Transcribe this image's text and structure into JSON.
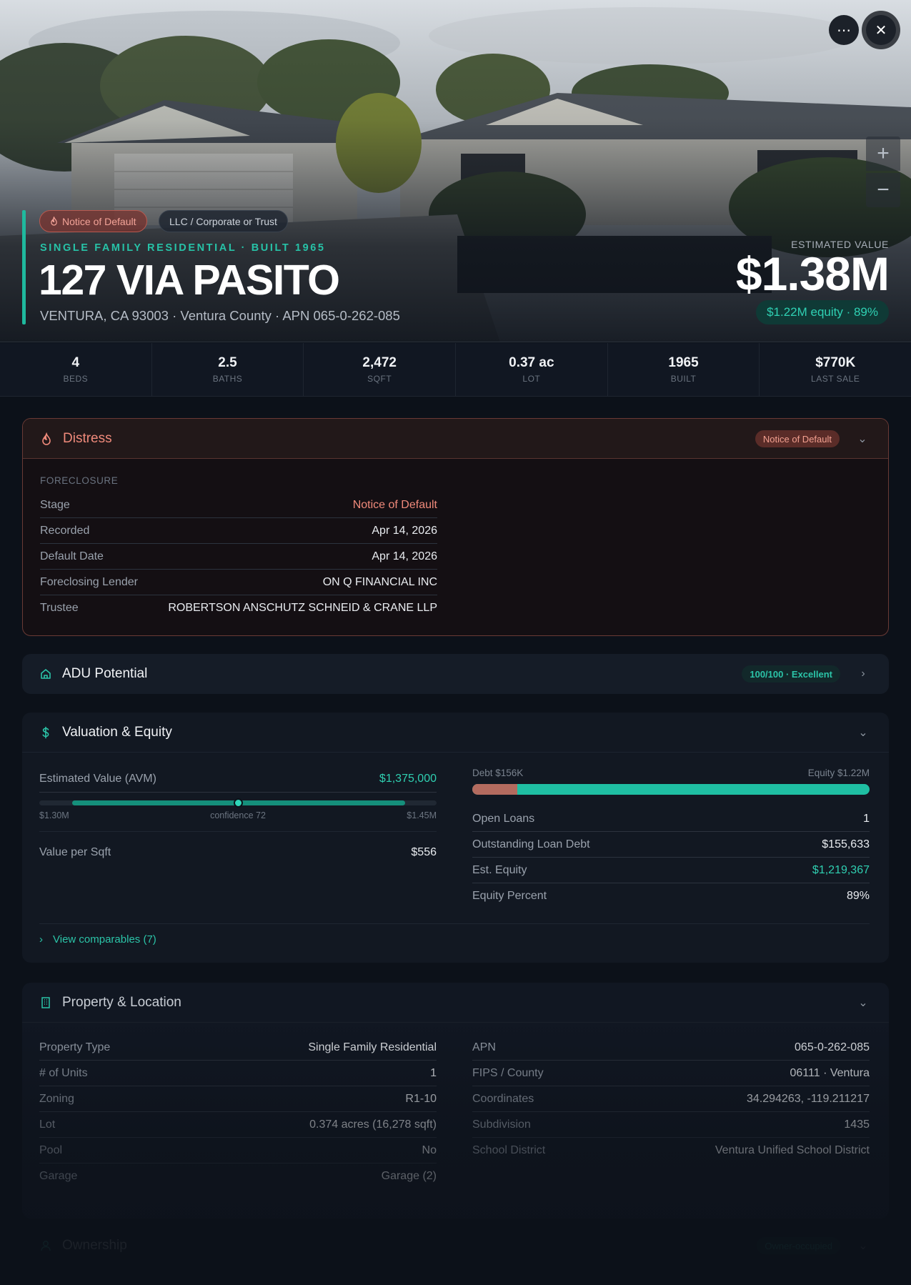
{
  "hero": {
    "more_icon": "ellipsis-icon",
    "close_icon": "close-icon",
    "zoom_in": "+",
    "zoom_out": "−",
    "tag_distress": "Notice of Default",
    "tag_owner_type": "LLC / Corporate or Trust",
    "subtitle": "SINGLE FAMILY RESIDENTIAL · BUILT 1965",
    "title": "127 VIA PASITO",
    "address": "VENTURA, CA 93003 · Ventura County · APN 065-0-262-085",
    "estimated_value_label": "ESTIMATED VALUE",
    "estimated_value": "$1.38M",
    "equity_pill": "$1.22M equity · 89%"
  },
  "stats": [
    {
      "value": "4",
      "label": "BEDS"
    },
    {
      "value": "2.5",
      "label": "BATHS"
    },
    {
      "value": "2,472",
      "label": "SQFT"
    },
    {
      "value": "0.37 ac",
      "label": "LOT"
    },
    {
      "value": "1965",
      "label": "BUILT"
    },
    {
      "value": "$770K",
      "label": "LAST SALE"
    }
  ],
  "distress": {
    "title": "Distress",
    "badge": "Notice of Default",
    "section_label": "FORECLOSURE",
    "rows": [
      {
        "k": "Stage",
        "v": "Notice of Default"
      },
      {
        "k": "Recorded",
        "v": "Apr 14, 2026"
      },
      {
        "k": "Default Date",
        "v": "Apr 14, 2026"
      },
      {
        "k": "Foreclosing Lender",
        "v": "ON Q FINANCIAL INC"
      },
      {
        "k": "Trustee",
        "v": "ROBERTSON ANSCHUTZ SCHNEID & CRANE LLP"
      }
    ]
  },
  "adu": {
    "title": "ADU Potential",
    "badge": "100/100 · Excellent"
  },
  "valuation": {
    "title": "Valuation & Equity",
    "avm_label": "Estimated Value (AVM)",
    "avm_value": "$1,375,000",
    "range_low": "$1.30M",
    "range_confidence": "confidence 72",
    "range_high": "$1.45M",
    "range_position": 0.5,
    "per_sqft_label": "Value per Sqft",
    "per_sqft_value": "$556",
    "debt_label": "Debt $156K",
    "equity_label": "Equity $1.22M",
    "debt_fraction": 0.113,
    "rows": [
      {
        "k": "Open Loans",
        "v": "1"
      },
      {
        "k": "Outstanding Loan Debt",
        "v": "$155,633"
      },
      {
        "k": "Est. Equity",
        "v": "$1,219,367"
      },
      {
        "k": "Equity Percent",
        "v": "89%"
      }
    ],
    "comparables_link": "View comparables (7)"
  },
  "property": {
    "title": "Property & Location",
    "left": [
      {
        "k": "Property Type",
        "v": "Single Family Residential"
      },
      {
        "k": "# of Units",
        "v": "1"
      },
      {
        "k": "Zoning",
        "v": "R1-10"
      },
      {
        "k": "Lot",
        "v": "0.374 acres (16,278 sqft)"
      },
      {
        "k": "Pool",
        "v": "No"
      },
      {
        "k": "Garage",
        "v": "Garage (2)"
      }
    ],
    "right": [
      {
        "k": "APN",
        "v": "065-0-262-085"
      },
      {
        "k": "FIPS / County",
        "v": "06111 · Ventura"
      },
      {
        "k": "Coordinates",
        "v": "34.294263, -119.211217"
      },
      {
        "k": "Subdivision",
        "v": "1435"
      },
      {
        "k": "School District",
        "v": "Ventura Unified School District"
      }
    ]
  },
  "ownership": {
    "title": "Ownership",
    "badge": "Owner-occupied"
  },
  "colors": {
    "accent": "#1fb99e",
    "distress": "#f08a7b",
    "background": "#0c1119"
  }
}
